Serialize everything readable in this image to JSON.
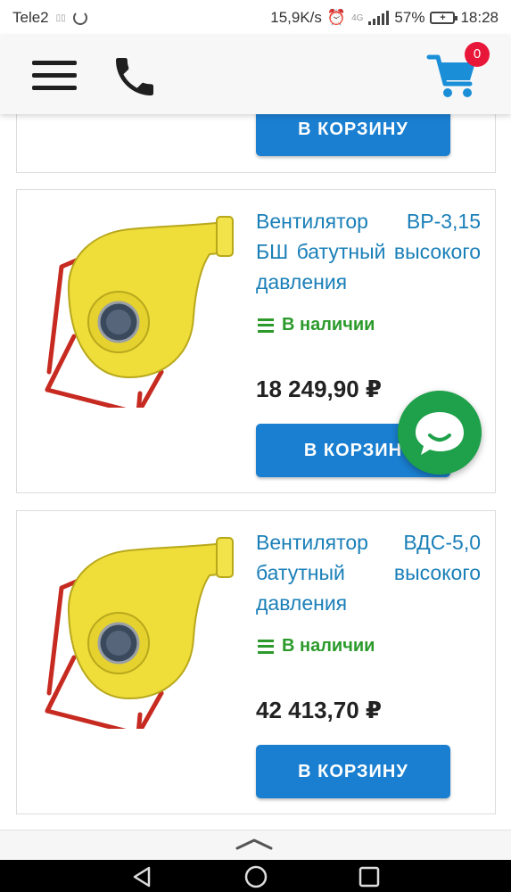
{
  "status_bar": {
    "carrier": "Tele2",
    "speed": "15,9K/s",
    "network": "4G",
    "battery": "57%",
    "time": "18:28"
  },
  "header": {
    "cart_count": "0",
    "accent_color": "#1a8fd8",
    "badge_color": "#e8173a"
  },
  "products": [
    {
      "title": "",
      "button_label": "В КОРЗИНУ"
    },
    {
      "title": "Вентилятор ВР-3,15 БШ батутный высокого давления",
      "stock": "В наличии",
      "price": "18 249,90 ₽",
      "button_label": "В КОРЗИН"
    },
    {
      "title": "Вентилятор ВДС-5,0 батутный высокого давления",
      "stock": "В наличии",
      "price": "42 413,70 ₽",
      "button_label": "В КОРЗИНУ"
    }
  ],
  "colors": {
    "link": "#1a7fb8",
    "stock_green": "#2b9a2b",
    "button_blue": "#1a7fd0",
    "chat_green": "#1fa04a"
  }
}
